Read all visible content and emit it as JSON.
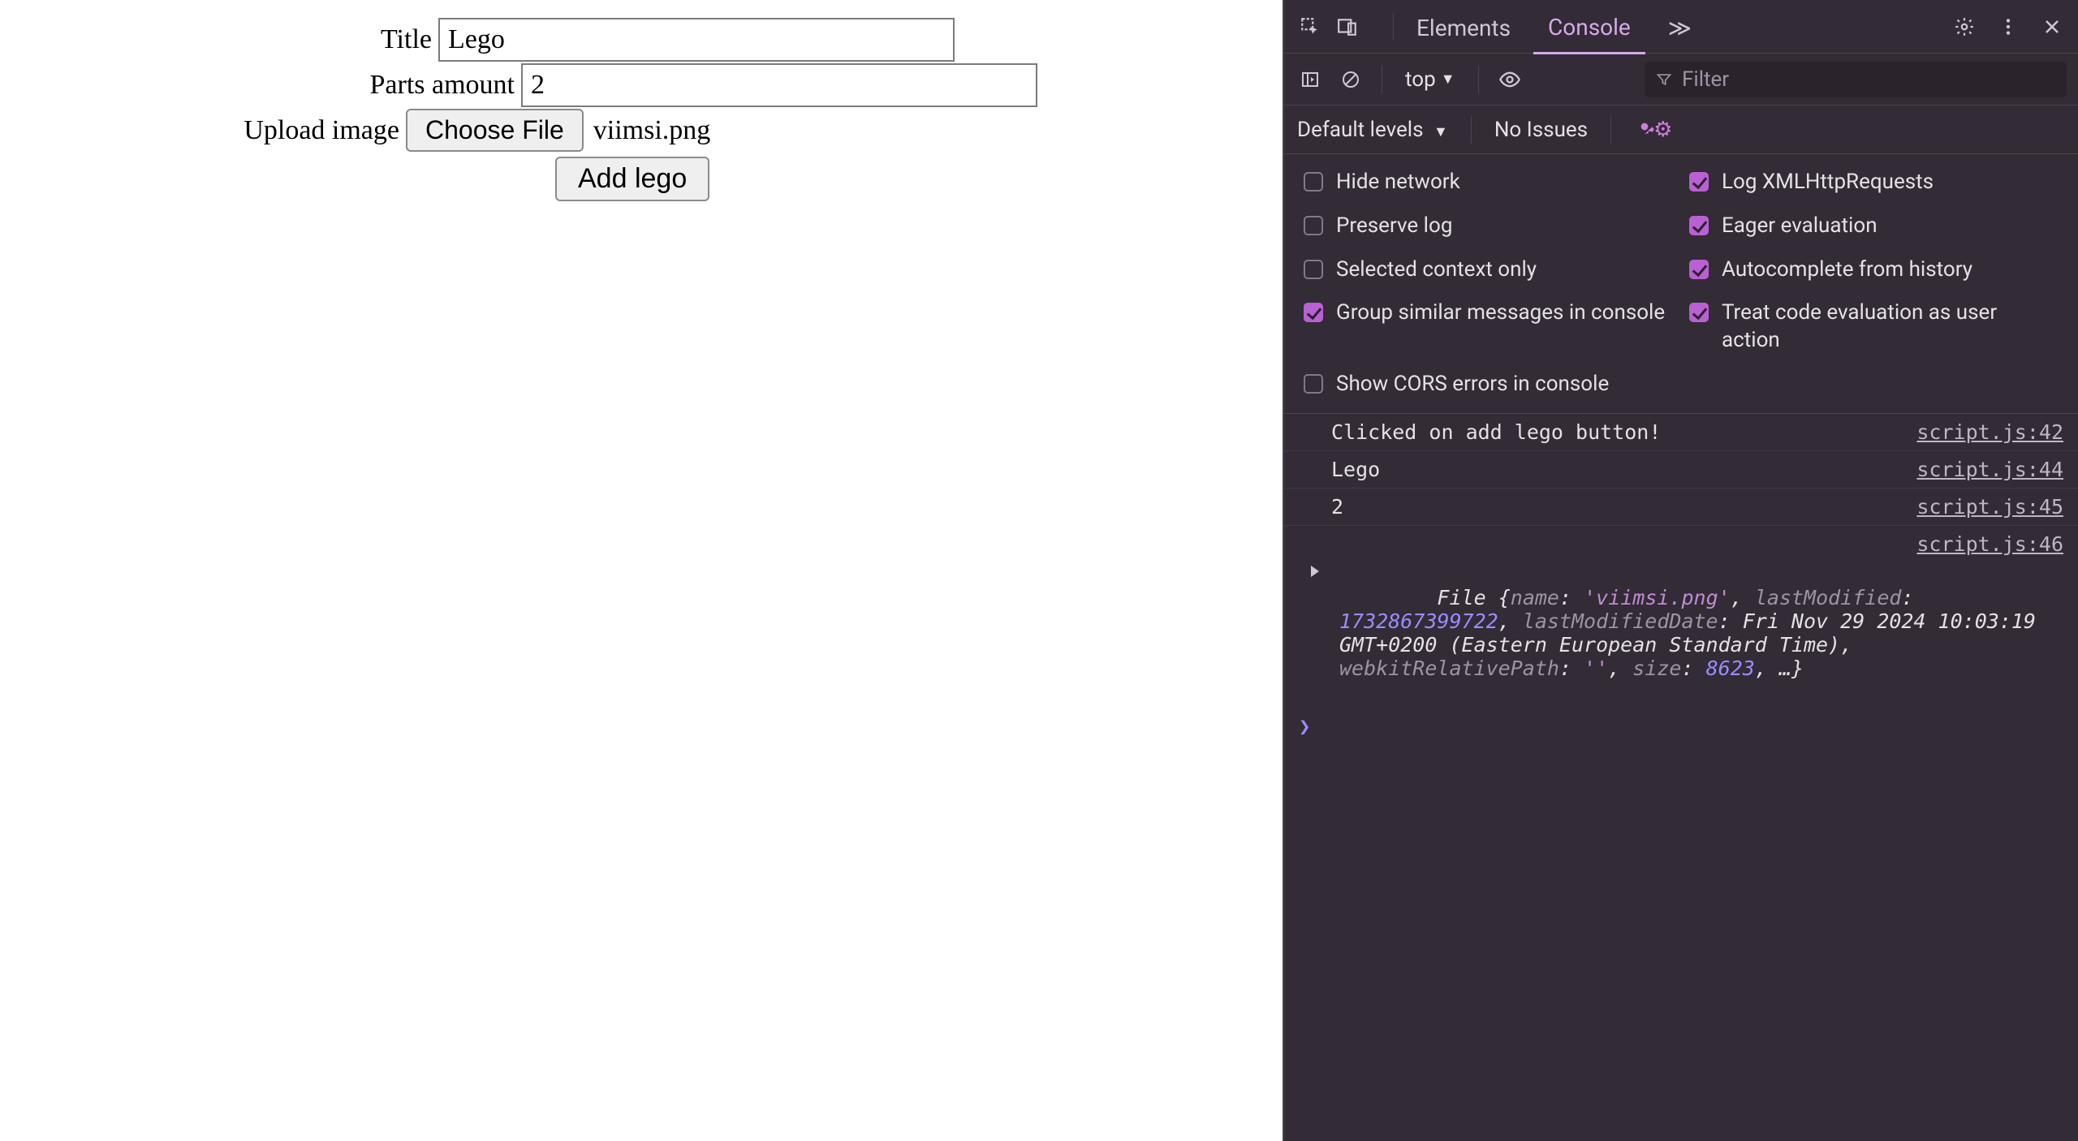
{
  "form": {
    "title_label": "Title",
    "title_value": "Lego",
    "parts_label": "Parts amount",
    "parts_value": "2",
    "upload_label": "Upload image",
    "choose_file_label": "Choose File",
    "file_name": "viimsi.png",
    "submit_label": "Add lego"
  },
  "devtools": {
    "tabs": {
      "elements": "Elements",
      "console": "Console",
      "more": "≫"
    },
    "toolbar": {
      "context": "top",
      "filter_placeholder": "Filter",
      "levels": "Default levels",
      "issues": "No Issues"
    },
    "settings": {
      "hide_network": "Hide network",
      "log_xhr": "Log XMLHttpRequests",
      "preserve_log": "Preserve log",
      "eager_eval": "Eager evaluation",
      "selected_ctx": "Selected context only",
      "autocomplete": "Autocomplete from history",
      "group_similar": "Group similar messages in console",
      "treat_eval": "Treat code evaluation as user action",
      "show_cors": "Show CORS errors in console",
      "checked": {
        "hide_network": false,
        "log_xhr": true,
        "preserve_log": false,
        "eager_eval": true,
        "selected_ctx": false,
        "autocomplete": true,
        "group_similar": true,
        "treat_eval": true,
        "show_cors": false
      }
    },
    "log": [
      {
        "msg": "Clicked on add lego button!",
        "src": "script.js:42"
      },
      {
        "msg": "Lego",
        "src": "script.js:44"
      },
      {
        "msg": "2",
        "src": "script.js:45"
      }
    ],
    "file_log": {
      "src": "script.js:46",
      "class": "File",
      "name_key": "name",
      "name_val": "'viimsi.png'",
      "lm_key": "lastModified",
      "lm_val": "1732867399722",
      "lmd_key": "lastModifiedDate",
      "lmd_val": "Fri Nov 29 2024 10:03:19 GMT+0200 (Eastern European Standard Time)",
      "wrp_key": "webkitRelativePath",
      "wrp_val": "''",
      "size_key": "size",
      "size_val": "8623",
      "ellipsis": ", …}"
    }
  }
}
